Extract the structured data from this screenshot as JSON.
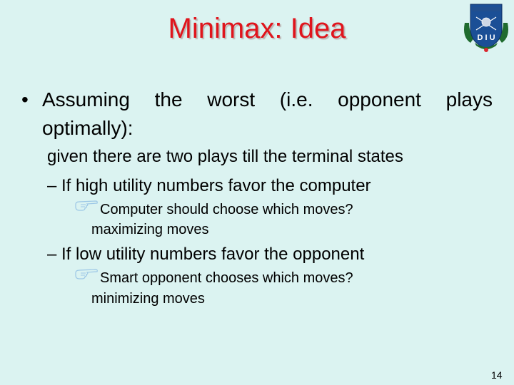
{
  "slide": {
    "title": "Minimax: Idea",
    "logo": {
      "name": "DIU university logo",
      "text": "D I U"
    },
    "bullet": {
      "symbol": "•",
      "text": "Assuming the worst (i.e. opponent plays optimally):"
    },
    "intro_line": "given there are two plays till the terminal states",
    "sub_points": [
      {
        "text": "– If high utility numbers favor the computer",
        "icon": "pointing-hand-icon",
        "question": "Computer should choose which moves?",
        "answer": "maximizing moves"
      },
      {
        "text": "– If low utility numbers favor the opponent",
        "icon": "pointing-hand-icon",
        "question": "Smart opponent chooses which moves?",
        "answer": "minimizing moves"
      }
    ],
    "page_number": "14",
    "colors": {
      "background": "#dbf3f1",
      "title": "#e0141c",
      "icon": "#9cc7e6"
    }
  }
}
